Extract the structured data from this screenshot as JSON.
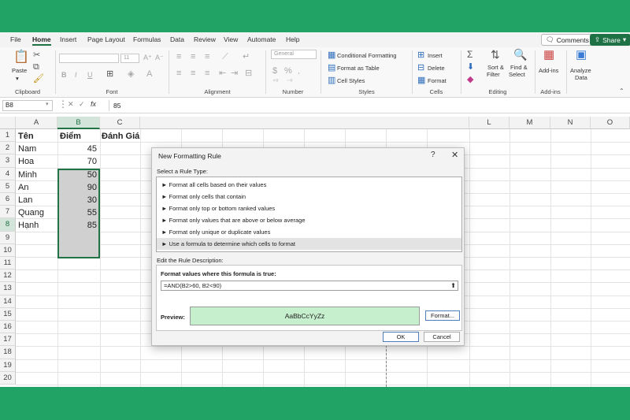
{
  "menu": {
    "tabs": [
      "File",
      "Home",
      "Insert",
      "Page Layout",
      "Formulas",
      "Data",
      "Review",
      "View",
      "Automate",
      "Help"
    ],
    "active": "Home",
    "comments_label": "Comments",
    "share_label": "Share"
  },
  "ribbon": {
    "clipboard": {
      "paste": "Paste",
      "label": "Clipboard"
    },
    "font": {
      "name": "",
      "size": "11",
      "label": "Font",
      "bold": "B",
      "italic": "I",
      "underline": "U"
    },
    "alignment": {
      "label": "Alignment"
    },
    "number": {
      "format": "General",
      "label": "Number",
      "currency": "$",
      "percent": "%"
    },
    "styles": {
      "conditional": "Conditional Formatting",
      "table": "Format as Table",
      "cell_styles": "Cell Styles",
      "label": "Styles"
    },
    "cells": {
      "insert": "Insert",
      "delete": "Delete",
      "format": "Format",
      "label": "Cells"
    },
    "editing": {
      "sort": "Sort &",
      "sort2": "Filter",
      "find": "Find &",
      "find2": "Select",
      "label": "Editing"
    },
    "addins": {
      "label": "Add-ins",
      "label2": "Add-ins"
    },
    "analyze": {
      "label": "Analyze",
      "label2": "Data"
    }
  },
  "formula_bar": {
    "name_box": "B8",
    "fx": "fx",
    "value": "85"
  },
  "grid": {
    "columns": [
      "A",
      "B",
      "C",
      "L",
      "M",
      "N",
      "O"
    ],
    "rows": [
      "1",
      "2",
      "3",
      "4",
      "5",
      "6",
      "7",
      "8",
      "9",
      "10",
      "11",
      "12",
      "13",
      "14",
      "15",
      "16",
      "17",
      "18",
      "19",
      "20"
    ],
    "headers": {
      "a1": "Tên",
      "b1": "Điểm",
      "c1": "Đánh Giá"
    },
    "names": [
      "Nam",
      "Hoa",
      "Minh",
      "An",
      "Lan",
      "Quang",
      "Hạnh"
    ],
    "scores": [
      "45",
      "70",
      "50",
      "90",
      "30",
      "55",
      "85"
    ]
  },
  "dialog": {
    "title": "New Formatting Rule",
    "help": "?",
    "close": "✕",
    "select_label": "Select a Rule Type:",
    "rules": [
      "► Format all cells based on their values",
      "► Format only cells that contain",
      "► Format only top or bottom ranked values",
      "► Format only values that are above or below average",
      "► Format only unique or duplicate values",
      "► Use a formula to determine which cells to format"
    ],
    "edit_label": "Edit the Rule Description:",
    "formula_title": "Format values where this formula is true:",
    "formula": "=AND(B2>60, B2<90)",
    "preview_label": "Preview:",
    "preview_text": "AaBbCcYyZz",
    "format_button": "Format...",
    "ok": "OK",
    "cancel": "Cancel"
  }
}
